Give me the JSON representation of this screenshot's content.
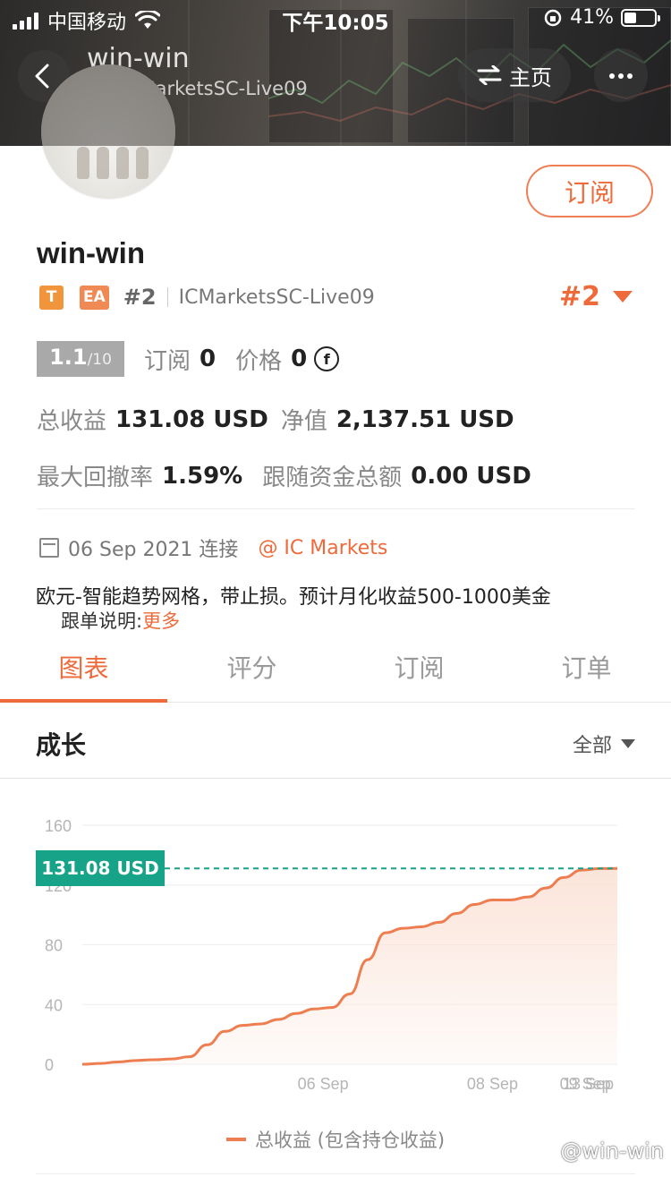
{
  "status_bar": {
    "carrier": "中国移动",
    "time": "下午10:05",
    "battery": "41%",
    "battery_level": 0.41
  },
  "header": {
    "title": "win-win",
    "subtitle": "#2 ICMarketsSC-Live09",
    "home_label": "主页"
  },
  "profile": {
    "name": "win-win",
    "subscribe_label": "订阅",
    "tag_t": "T",
    "tag_ea": "EA",
    "rank": "#2",
    "server": "ICMarketsSC-Live09",
    "rank_big": "#2"
  },
  "stats": {
    "rating": "1.1",
    "rating_max": "/10",
    "subscribe_label": "订阅",
    "subscribe_count": "0",
    "price_label": "价格",
    "price_value": "0",
    "coin_symbol": "f",
    "total_profit_label": "总收益",
    "total_profit_value": "131.08 USD",
    "equity_label": "净值",
    "equity_value": "2,137.51 USD",
    "drawdown_label": "最大回撤率",
    "drawdown_value": "1.59%",
    "follow_funds_label": "跟随资金总额",
    "follow_funds_value": "0.00 USD"
  },
  "connection": {
    "date": "06 Sep 2021 连接",
    "broker": "@ IC Markets"
  },
  "description": "欧元-智能趋势网格，带止损。预计月化收益500-1000美金",
  "follow_note": {
    "label": "跟单说明:",
    "link": "更多"
  },
  "tabs": [
    "图表",
    "评分",
    "订阅",
    "订单"
  ],
  "section": {
    "title": "成长",
    "filter": "全部"
  },
  "chart_data": {
    "type": "area",
    "current_value_label": "131.08 USD",
    "current_value": 131.08,
    "yticks": [
      "160",
      "120",
      "80",
      "40",
      "0"
    ],
    "ylim": [
      0,
      160
    ],
    "xticks": [
      "06 Sep",
      "08 Sep",
      "09 Sep",
      "13 Sep"
    ],
    "series": [
      {
        "name": "总收益 (包含持仓收益)",
        "x": [
          0,
          0.1,
          0.2,
          0.3,
          0.4,
          0.5,
          0.6,
          0.7,
          0.8,
          0.9,
          1.0,
          1.1,
          1.2,
          1.3,
          1.4,
          1.5,
          1.6,
          1.7,
          1.8,
          1.9,
          2.0,
          2.1,
          2.2,
          2.3,
          2.4,
          2.5,
          2.6,
          2.7,
          2.8,
          2.9,
          3.0
        ],
        "values": [
          0,
          0.5,
          1.5,
          2.5,
          3,
          3.5,
          5,
          13,
          22,
          26,
          27,
          30,
          34,
          37,
          38,
          47,
          70,
          88,
          91,
          92,
          95,
          101,
          107,
          110,
          110,
          112,
          118,
          125,
          130,
          131,
          131.08
        ]
      }
    ],
    "legend": "总收益 (包含持仓收益)",
    "colors": {
      "line": "#ee7d4f",
      "fill": "#fbe3d8",
      "reference": "#17a388",
      "grid": "#eeeeee"
    }
  },
  "watermark": "@win-win"
}
